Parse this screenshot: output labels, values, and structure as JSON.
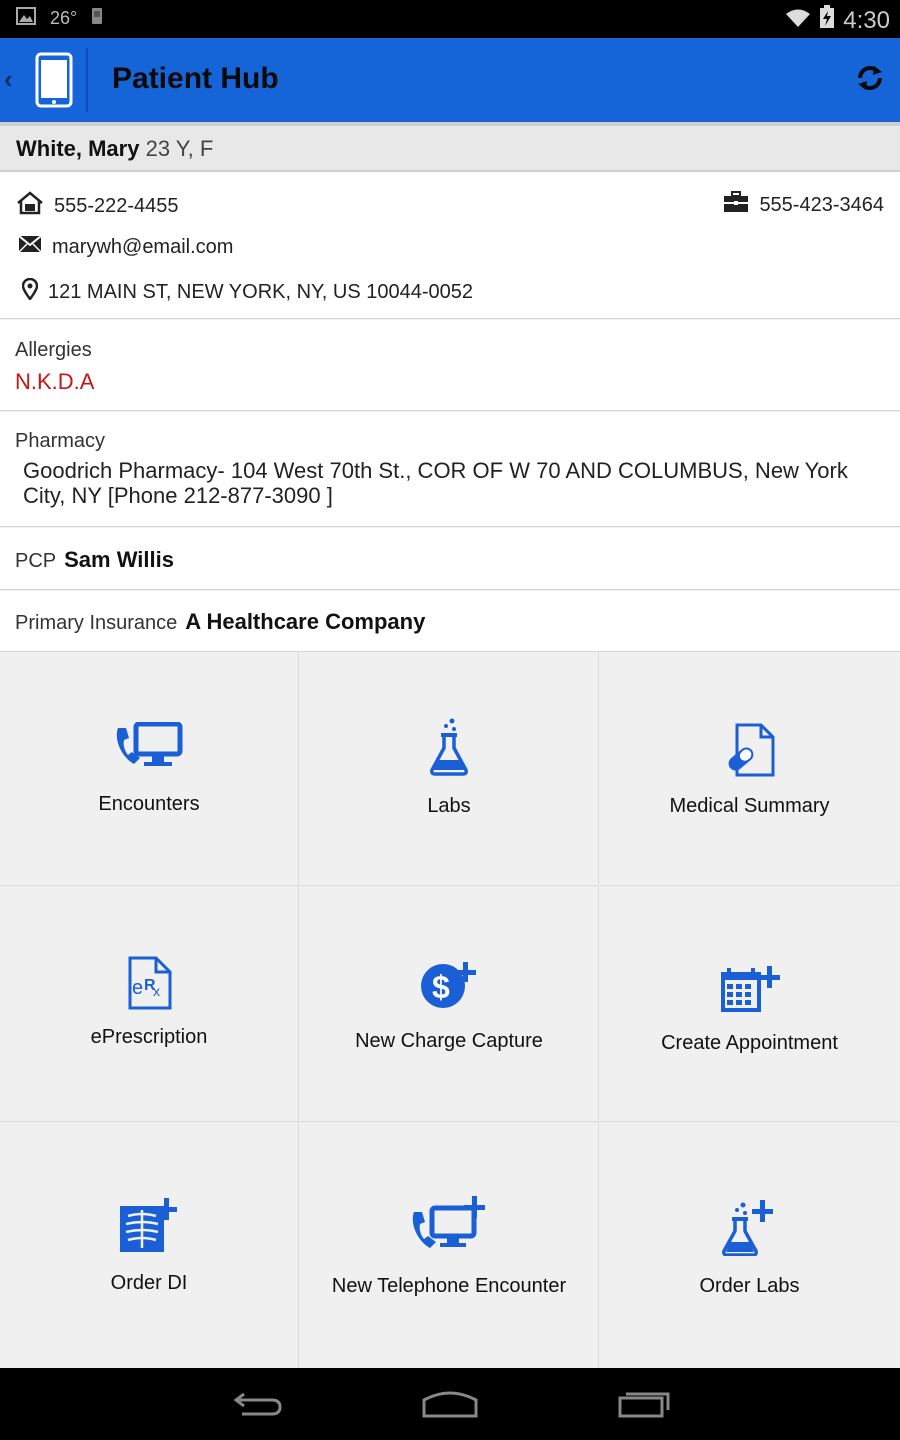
{
  "status": {
    "temperature": "26°",
    "time": "4:30"
  },
  "app": {
    "title": "Patient Hub"
  },
  "patient": {
    "name": "White, Mary",
    "age_sex": "23 Y, F"
  },
  "contact": {
    "home_phone": "555-222-4455",
    "work_phone": "555-423-3464",
    "email": "marywh@email.com",
    "address": "121 MAIN ST, NEW YORK, NY, US 10044-0052"
  },
  "allergies": {
    "label": "Allergies",
    "value": "N.K.D.A"
  },
  "pharmacy": {
    "label": "Pharmacy",
    "value": "Goodrich Pharmacy- 104 West 70th St., COR OF W 70 AND COLUMBUS, New York City, NY [Phone 212-877-3090 ]"
  },
  "pcp": {
    "label": "PCP",
    "value": "Sam Willis"
  },
  "insurance": {
    "label": "Primary Insurance",
    "value": "A Healthcare Company"
  },
  "tiles": [
    {
      "label": "Encounters",
      "icon": "encounters-icon"
    },
    {
      "label": "Labs",
      "icon": "labs-flask-icon"
    },
    {
      "label": "Medical Summary",
      "icon": "medical-summary-icon"
    },
    {
      "label": "ePrescription",
      "icon": "eprescription-icon"
    },
    {
      "label": "New Charge Capture",
      "icon": "charge-capture-icon"
    },
    {
      "label": "Create Appointment",
      "icon": "calendar-add-icon"
    },
    {
      "label": "Order DI",
      "icon": "xray-add-icon"
    },
    {
      "label": "New Telephone Encounter",
      "icon": "telephone-encounter-add-icon"
    },
    {
      "label": "Order Labs",
      "icon": "flask-add-icon"
    }
  ],
  "colors": {
    "accent": "#1565d8",
    "icon_blue": "#1a5fd6",
    "allergy_red": "#c41818"
  }
}
